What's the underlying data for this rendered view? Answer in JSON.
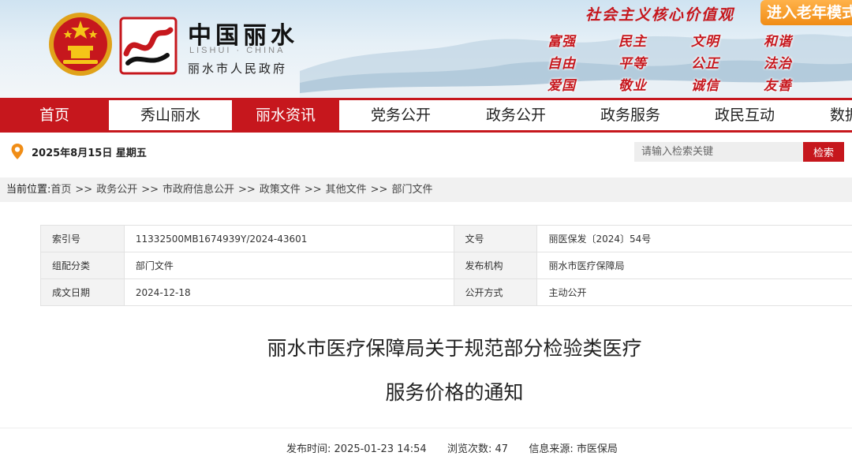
{
  "header": {
    "site_title": "中国丽水",
    "site_subtitle": "LISHUI · CHINA",
    "site_name": "丽水市人民政府",
    "slogan": "社会主义核心价值观",
    "elderly_mode": "进入老年模式",
    "core_values": [
      "富强",
      "民主",
      "文明",
      "和谐",
      "自由",
      "平等",
      "公正",
      "法治",
      "爱国",
      "敬业",
      "诚信",
      "友善"
    ]
  },
  "nav": {
    "items": [
      {
        "label": "首页",
        "active": true
      },
      {
        "label": "秀山丽水",
        "active": false
      },
      {
        "label": "丽水资讯",
        "active": true
      },
      {
        "label": "党务公开",
        "active": false
      },
      {
        "label": "政务公开",
        "active": false
      },
      {
        "label": "政务服务",
        "active": false
      },
      {
        "label": "政民互动",
        "active": false
      },
      {
        "label": "数据开放",
        "active": false
      }
    ]
  },
  "date_bar": {
    "date": "2025年8月15日 星期五",
    "search_placeholder": "请输入检索关键",
    "search_button": "检索"
  },
  "breadcrumb": {
    "label": "当前位置:",
    "items": [
      "首页",
      "政务公开",
      "市政府信息公开",
      "政策文件",
      "其他文件",
      "部门文件"
    ],
    "separator": ">>"
  },
  "meta": {
    "index_label": "索引号",
    "index_value": "11332500MB1674939Y/2024-43601",
    "doc_no_label": "文号",
    "doc_no_value": "丽医保发〔2024〕54号",
    "category_label": "组配分类",
    "category_value": "部门文件",
    "issuer_label": "发布机构",
    "issuer_value": "丽水市医疗保障局",
    "date_label": "成文日期",
    "date_value": "2024-12-18",
    "method_label": "公开方式",
    "method_value": "主动公开"
  },
  "article": {
    "title_line1": "丽水市医疗保障局关于规范部分检验类医疗",
    "title_line2": "服务价格的通知",
    "publish_label": "发布时间:",
    "publish_time": "2025-01-23 14:54",
    "views_label": "浏览次数:",
    "views": "47",
    "source_label": "信息来源:",
    "source": "市医保局"
  },
  "colors": {
    "brand_red": "#c6171d",
    "elderly_orange": "#f08d16",
    "breadcrumb_bg": "#f1f1f1"
  }
}
